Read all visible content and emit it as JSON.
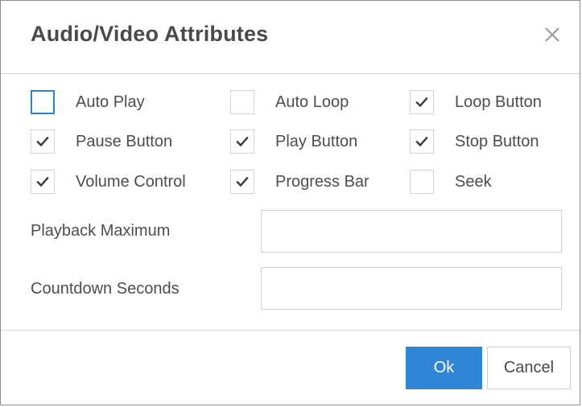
{
  "dialog": {
    "title": "Audio/Video Attributes",
    "close_icon": "close-icon"
  },
  "options": [
    {
      "label": "Auto Play",
      "checked": false,
      "focused": true
    },
    {
      "label": "Auto Loop",
      "checked": false,
      "focused": false
    },
    {
      "label": "Loop Button",
      "checked": true,
      "focused": false
    },
    {
      "label": "Pause Button",
      "checked": true,
      "focused": false
    },
    {
      "label": "Play Button",
      "checked": true,
      "focused": false
    },
    {
      "label": "Stop Button",
      "checked": true,
      "focused": false
    },
    {
      "label": "Volume Control",
      "checked": true,
      "focused": false
    },
    {
      "label": "Progress Bar",
      "checked": true,
      "focused": false
    },
    {
      "label": "Seek",
      "checked": false,
      "focused": false
    }
  ],
  "fields": {
    "playback_maximum": {
      "label": "Playback Maximum",
      "value": ""
    },
    "countdown_seconds": {
      "label": "Countdown Seconds",
      "value": ""
    }
  },
  "buttons": {
    "ok": "Ok",
    "cancel": "Cancel"
  },
  "colors": {
    "primary": "#2e86d4",
    "focus": "#2a80c9",
    "text": "#4d4d4d"
  }
}
